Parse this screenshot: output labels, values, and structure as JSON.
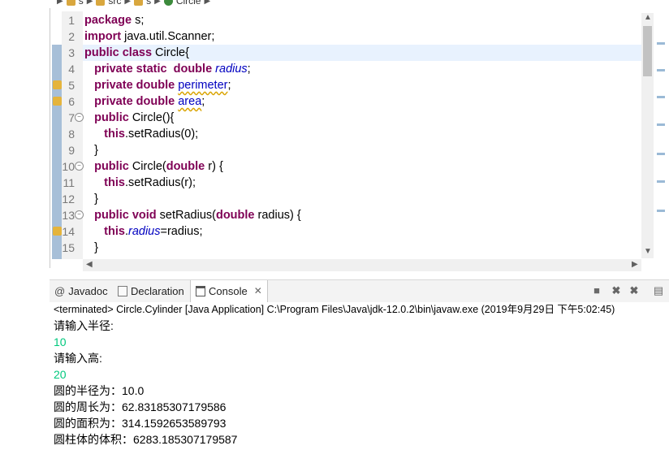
{
  "breadcrumb": {
    "items": [
      "s",
      "src",
      "s",
      "Circle"
    ]
  },
  "editor": {
    "line_numbers": [
      "1",
      "2",
      "3",
      "4",
      "5",
      "6",
      "7",
      "8",
      "9",
      "10",
      "11",
      "12",
      "13",
      "14",
      "15"
    ],
    "lines": [
      [
        [
          "kw",
          "package"
        ],
        [
          "t",
          " s;"
        ]
      ],
      [
        [
          "kw",
          "import"
        ],
        [
          "t",
          " java.util.Scanner;"
        ]
      ],
      [
        [
          "kw",
          "public class"
        ],
        [
          "t",
          " Circle{"
        ]
      ],
      [
        [
          "t",
          "   "
        ],
        [
          "kw",
          "private static  double"
        ],
        [
          "t",
          " "
        ],
        [
          "fld",
          "radius"
        ],
        [
          "t",
          ";"
        ]
      ],
      [
        [
          "t",
          "   "
        ],
        [
          "kw",
          "private double"
        ],
        [
          "t",
          " "
        ],
        [
          "fldw",
          "perimeter"
        ],
        [
          "t",
          ";"
        ]
      ],
      [
        [
          "t",
          "   "
        ],
        [
          "kw",
          "private double"
        ],
        [
          "t",
          " "
        ],
        [
          "fldw",
          "area"
        ],
        [
          "t",
          ";"
        ]
      ],
      [
        [
          "t",
          "   "
        ],
        [
          "kw",
          "public"
        ],
        [
          "t",
          " Circle(){"
        ]
      ],
      [
        [
          "t",
          "      "
        ],
        [
          "kw",
          "this"
        ],
        [
          "t",
          ".setRadius(0);"
        ]
      ],
      [
        [
          "t",
          "   }"
        ]
      ],
      [
        [
          "t",
          "   "
        ],
        [
          "kw",
          "public"
        ],
        [
          "t",
          " Circle("
        ],
        [
          "kw",
          "double"
        ],
        [
          "t",
          " r) {"
        ]
      ],
      [
        [
          "t",
          "      "
        ],
        [
          "kw",
          "this"
        ],
        [
          "t",
          ".setRadius(r);"
        ]
      ],
      [
        [
          "t",
          "   }"
        ]
      ],
      [
        [
          "t",
          "   "
        ],
        [
          "kw",
          "public void"
        ],
        [
          "t",
          " setRadius("
        ],
        [
          "kw",
          "double"
        ],
        [
          "t",
          " radius) {"
        ]
      ],
      [
        [
          "t",
          "      "
        ],
        [
          "kw",
          "this"
        ],
        [
          "t",
          "."
        ],
        [
          "fld",
          "radius"
        ],
        [
          "t",
          "=radius;"
        ]
      ],
      [
        [
          "t",
          "   }"
        ]
      ]
    ],
    "colors": {
      "keyword": "#7f0055",
      "field": "#0000c0",
      "current_line": "#e8f2fe",
      "change_ruler": "#5f8ab8",
      "console_input": "#00c87d"
    }
  },
  "views": {
    "tabs": [
      {
        "label": "Javadoc",
        "icon": "javadoc-icon"
      },
      {
        "label": "Declaration",
        "icon": "declaration-icon"
      },
      {
        "label": "Console",
        "icon": "console-icon",
        "active": true
      }
    ],
    "toolbar_icons": [
      "terminate-icon",
      "remove-launch-icon",
      "remove-all-terminated-icon",
      "pin-console-icon"
    ]
  },
  "console": {
    "terminated": "<terminated> Circle.Cylinder [Java Application] C:\\Program Files\\Java\\jdk-12.0.2\\bin\\javaw.exe (2019年9月29日 下午5:02:45)",
    "output": [
      {
        "text": "请输入半径:",
        "input": false
      },
      {
        "text": "10",
        "input": true
      },
      {
        "text": "请输入高:",
        "input": false
      },
      {
        "text": "20",
        "input": true
      },
      {
        "text": "圆的半径为：10.0",
        "input": false
      },
      {
        "text": "圆的周长为：62.83185307179586",
        "input": false
      },
      {
        "text": "圆的面积为：314.1592653589793",
        "input": false
      },
      {
        "text": "圆柱体的体积：6283.185307179587",
        "input": false
      }
    ]
  }
}
